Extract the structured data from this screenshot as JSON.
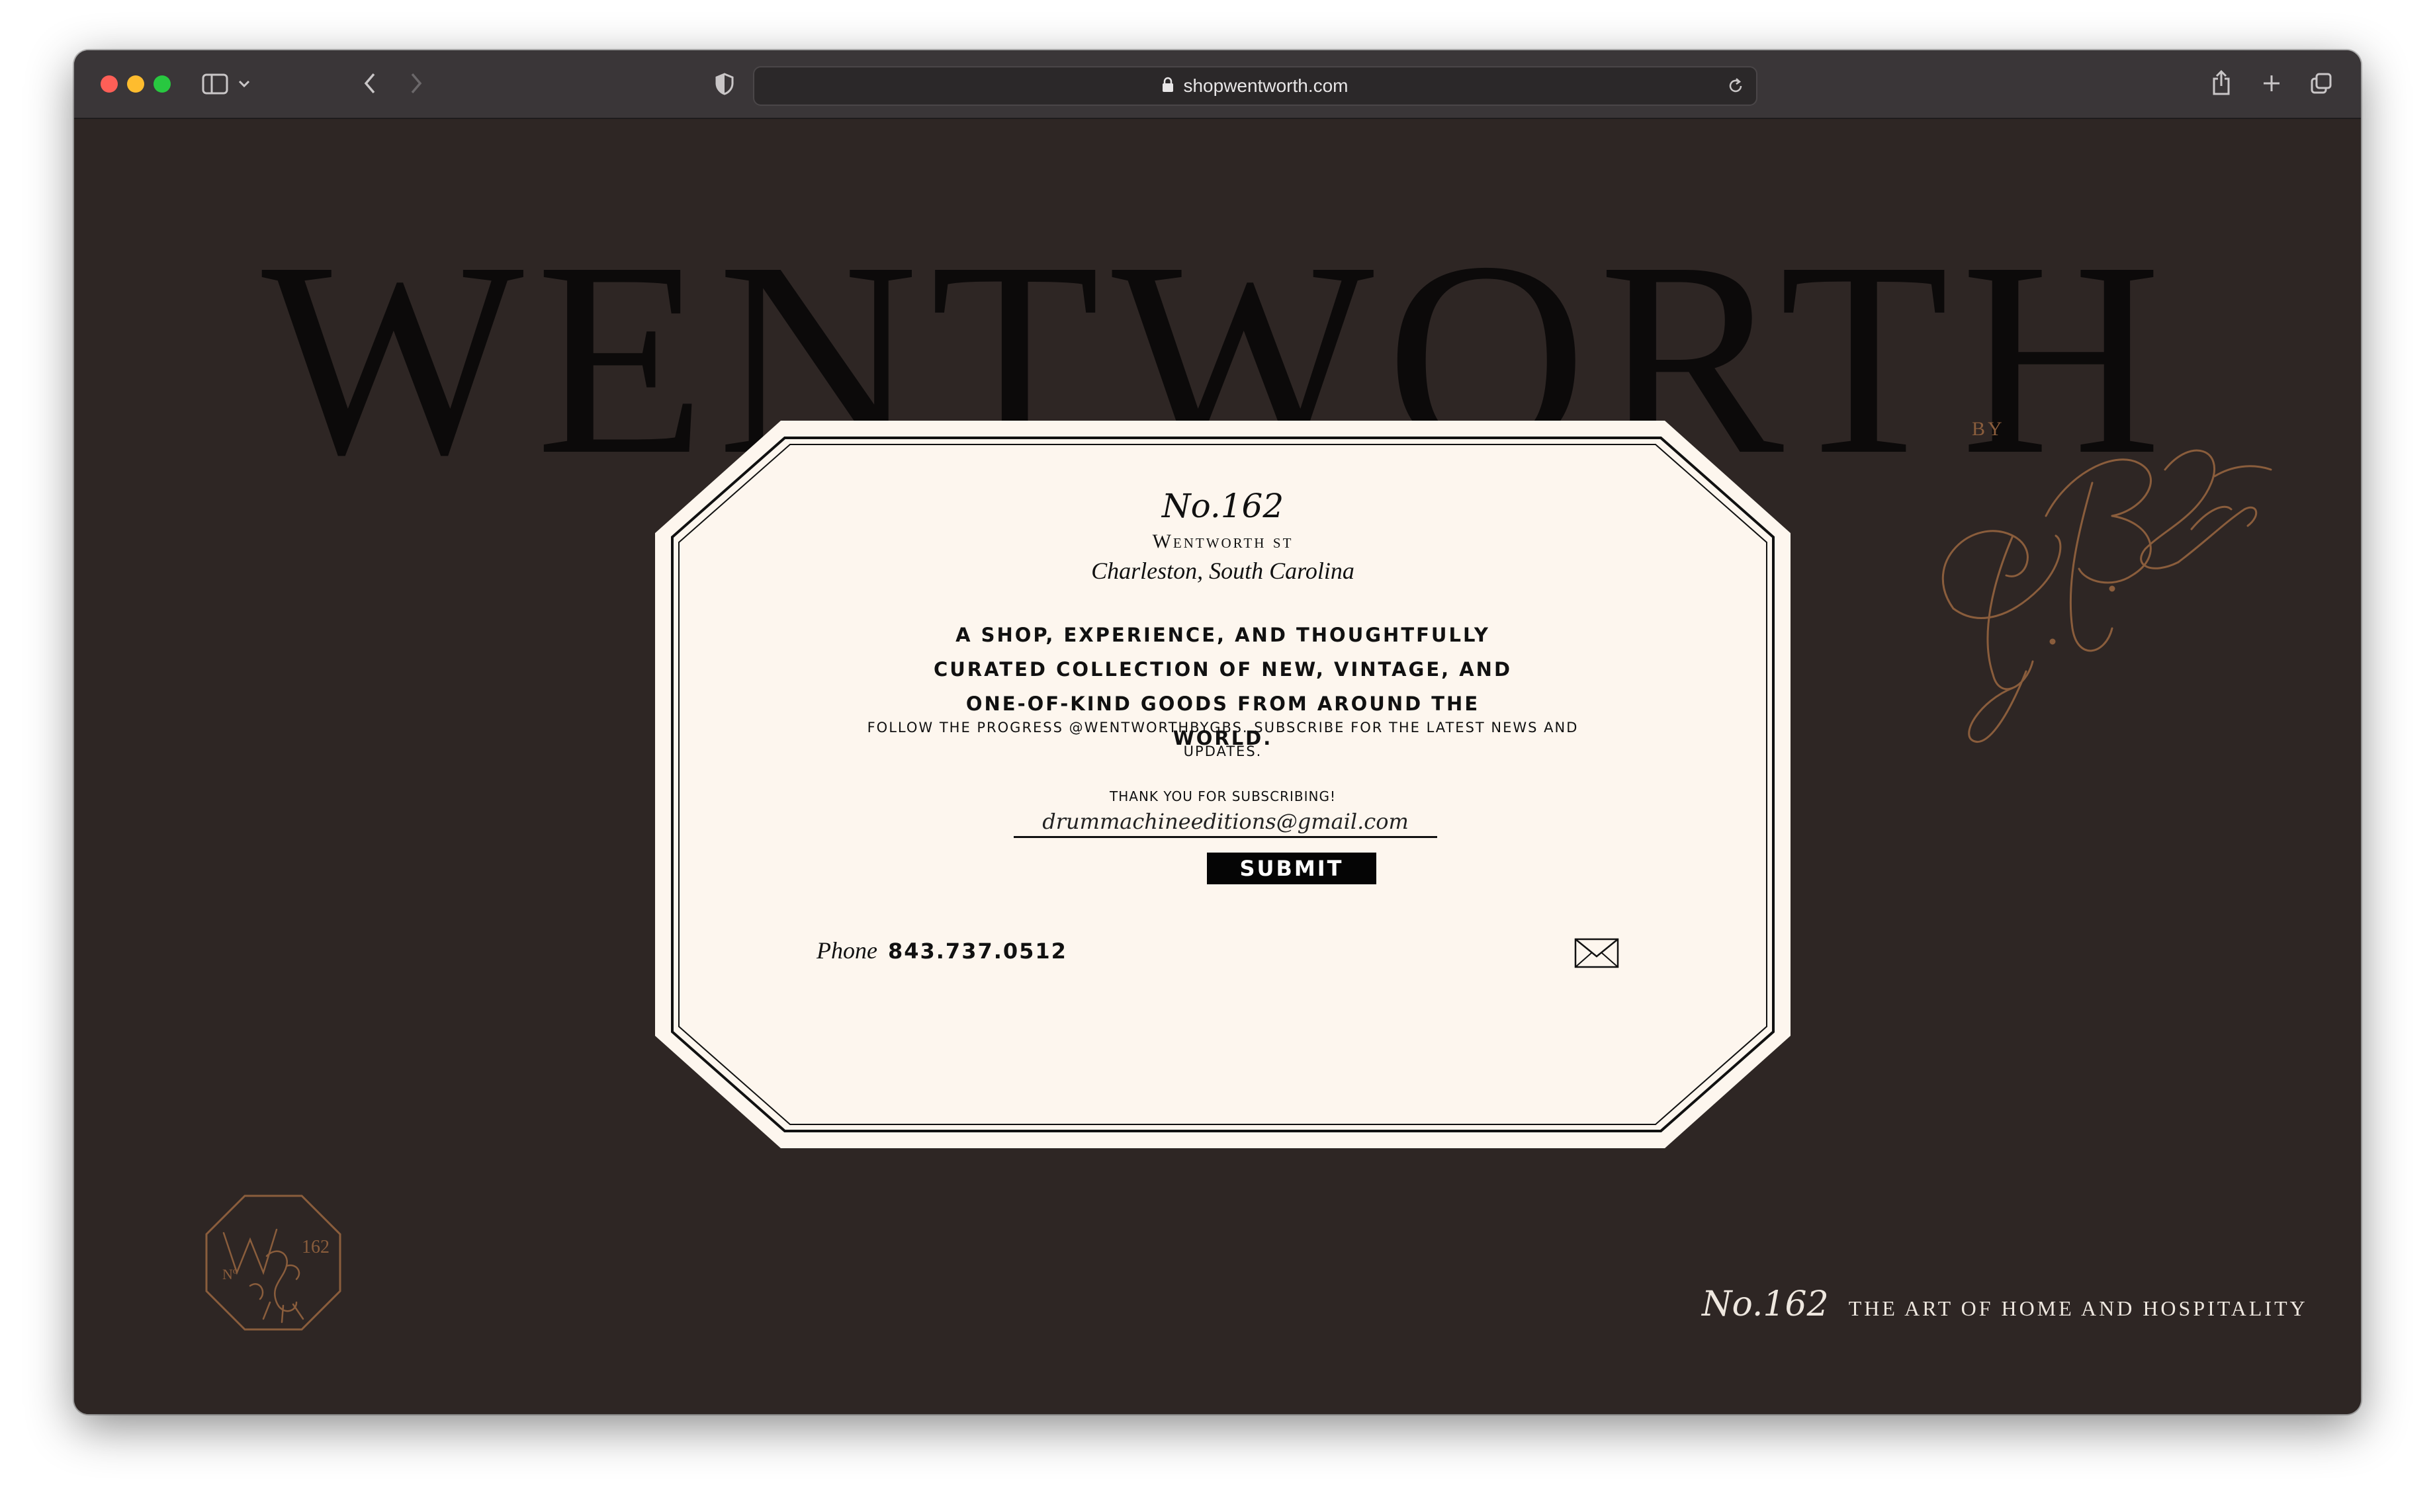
{
  "browser": {
    "url": "shopwentworth.com",
    "traffic_lights": [
      "#fe5f57",
      "#febc2e",
      "#28c840"
    ]
  },
  "hero": {
    "title": "WENTWORTH",
    "by": "BY",
    "signature": "G.B. Sams"
  },
  "card": {
    "number": "No.162",
    "street": "Wentworth st",
    "city": "Charleston, South Carolina",
    "tagline": "A SHOP, EXPERIENCE, AND THOUGHTFULLY CURATED COLLECTION OF NEW, VINTAGE, AND ONE-OF-KIND GOODS FROM AROUND THE WORLD.",
    "follow": "FOLLOW THE PROGRESS @WENTWORTHBYGBS. SUBSCRIBE FOR THE LATEST NEWS AND UPDATES.",
    "thanks": "THANK YOU FOR SUBSCRIBING!",
    "email_value": "drummachineeditions@gmail.com",
    "submit_label": "SUBMIT",
    "phone_label": "Phone",
    "phone_number": "843.737.0512"
  },
  "footer": {
    "number": "No.162",
    "text": "THE ART OF HOME AND HOSPITALITY"
  },
  "colors": {
    "background": "#2e2624",
    "card": "#fdf6ee",
    "accent_copper": "#8a5d3c",
    "hero_text": "#0c0a0a"
  },
  "icons": [
    "sidebar-icon",
    "chevron-down-icon",
    "back-icon",
    "forward-icon",
    "shield-icon",
    "lock-icon",
    "reload-icon",
    "share-icon",
    "new-tab-icon",
    "tabs-overview-icon",
    "mail-icon",
    "seal-logo"
  ]
}
